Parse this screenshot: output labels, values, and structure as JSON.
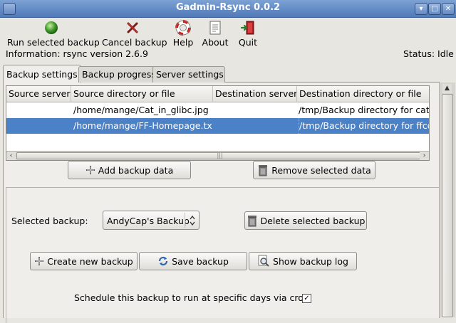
{
  "window": {
    "title": "Gadmin-Rsync 0.0.2",
    "minimize_glyph": "▾",
    "maximize_glyph": "□",
    "close_glyph": "✕"
  },
  "toolbar": {
    "run_label": "Run selected backup",
    "cancel_label": "Cancel backup",
    "help_label": "Help",
    "about_label": "About",
    "quit_label": "Quit"
  },
  "info": {
    "information": "Information: rsync  version 2.6.9",
    "status": "Status: Idle"
  },
  "tabs": [
    "Backup settings",
    "Backup progress",
    "Server settings"
  ],
  "table": {
    "columns": [
      "Source server",
      "Source directory or file",
      "Destination server",
      "Destination directory or file"
    ],
    "rows": [
      [
        "",
        "/home/mange/Cat_in_glibc.jpg",
        "",
        "/tmp/Backup directory for cats"
      ],
      [
        "",
        "/home/mange/FF-Homepage.txt",
        "",
        "/tmp/Backup directory for ffcod"
      ]
    ],
    "selected_row": 1
  },
  "buttons": {
    "add_backup_data": "Add backup data",
    "remove_selected_data": "Remove selected data",
    "delete_selected_backup": "Delete selected backup",
    "create_new_backup": "Create new backup",
    "save_backup": "Save backup",
    "show_backup_log": "Show backup log"
  },
  "selected_backup": {
    "label": "Selected backup:",
    "value": "AndyCap's Backup"
  },
  "schedule": {
    "label": "Schedule this backup to run at specific days via cron:",
    "checked": true,
    "check_glyph": "✓"
  },
  "scroll": {
    "left": "‹",
    "right": "›",
    "up": "▲",
    "down": "▼",
    "grip": "|||"
  },
  "colors": {
    "titlebar": "#4f79b8",
    "selection": "#4b81c6",
    "window_bg": "#e8e6e1"
  }
}
